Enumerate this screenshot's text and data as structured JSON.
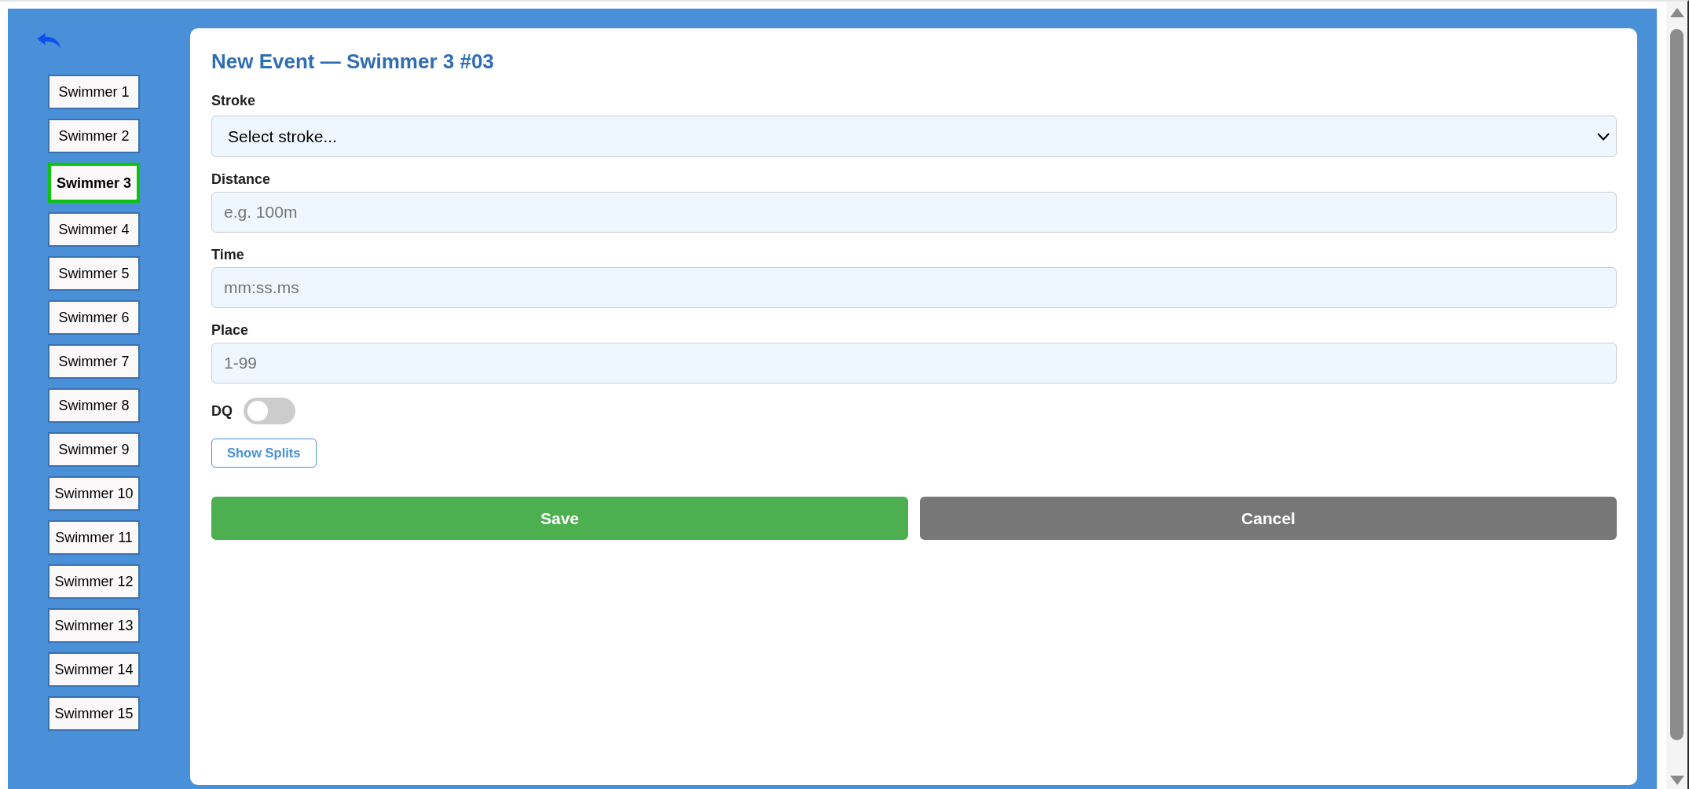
{
  "sidebar": {
    "swimmers": [
      {
        "label": "Swimmer 1",
        "selected": false
      },
      {
        "label": "Swimmer 2",
        "selected": false
      },
      {
        "label": "Swimmer 3",
        "selected": true
      },
      {
        "label": "Swimmer 4",
        "selected": false
      },
      {
        "label": "Swimmer 5",
        "selected": false
      },
      {
        "label": "Swimmer 6",
        "selected": false
      },
      {
        "label": "Swimmer 7",
        "selected": false
      },
      {
        "label": "Swimmer 8",
        "selected": false
      },
      {
        "label": "Swimmer 9",
        "selected": false
      },
      {
        "label": "Swimmer 10",
        "selected": false
      },
      {
        "label": "Swimmer 11",
        "selected": false
      },
      {
        "label": "Swimmer 12",
        "selected": false
      },
      {
        "label": "Swimmer 13",
        "selected": false
      },
      {
        "label": "Swimmer 14",
        "selected": false
      },
      {
        "label": "Swimmer 15",
        "selected": false
      }
    ]
  },
  "form": {
    "title": "New Event — Swimmer 3 #03",
    "fields": [
      {
        "kind": "select",
        "label": "Stroke",
        "value": "Select stroke..."
      },
      {
        "kind": "input",
        "label": "Distance",
        "placeholder": "e.g. 100m"
      },
      {
        "kind": "input",
        "label": "Time",
        "placeholder": "mm:ss.ms"
      },
      {
        "kind": "input",
        "label": "Place",
        "placeholder": "1-99"
      }
    ],
    "dq": {
      "label": "DQ",
      "on": false
    },
    "splits_button": "Show Splits",
    "actions": [
      {
        "kind": "save",
        "label": "Save"
      },
      {
        "kind": "cancel",
        "label": "Cancel"
      }
    ]
  }
}
